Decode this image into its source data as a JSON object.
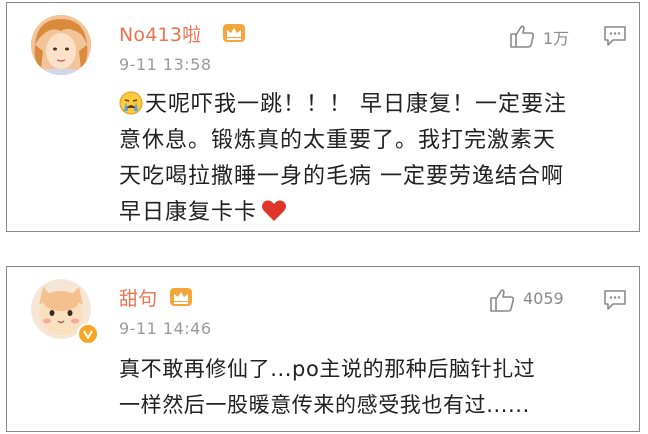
{
  "comments": [
    {
      "username": "No413啦",
      "time": "9-11 13:58",
      "likes": "1万",
      "lines": [
        "天呢吓我一跳！！！ 早日康复！一定要注",
        "意休息。锻炼真的太重要了。我打完激素天",
        "天吃喝拉撒睡一身的毛病 一定要劳逸结合啊",
        "早日康复卡卡"
      ],
      "emoji_start": "crying-face",
      "emoji_end": "red-heart"
    },
    {
      "username": "甜句",
      "time": "9-11 14:46",
      "likes": "4059",
      "lines": [
        "真不敢再修仙了...po主说的那种后脑针扎过",
        "一样然后一股暖意传来的感受我也有过......"
      ]
    }
  ],
  "colors": {
    "username": "#eb7350",
    "time": "#9a9a9a",
    "text": "#222222",
    "crown": "#f3a73b",
    "vip_badge": "#f6a623"
  }
}
